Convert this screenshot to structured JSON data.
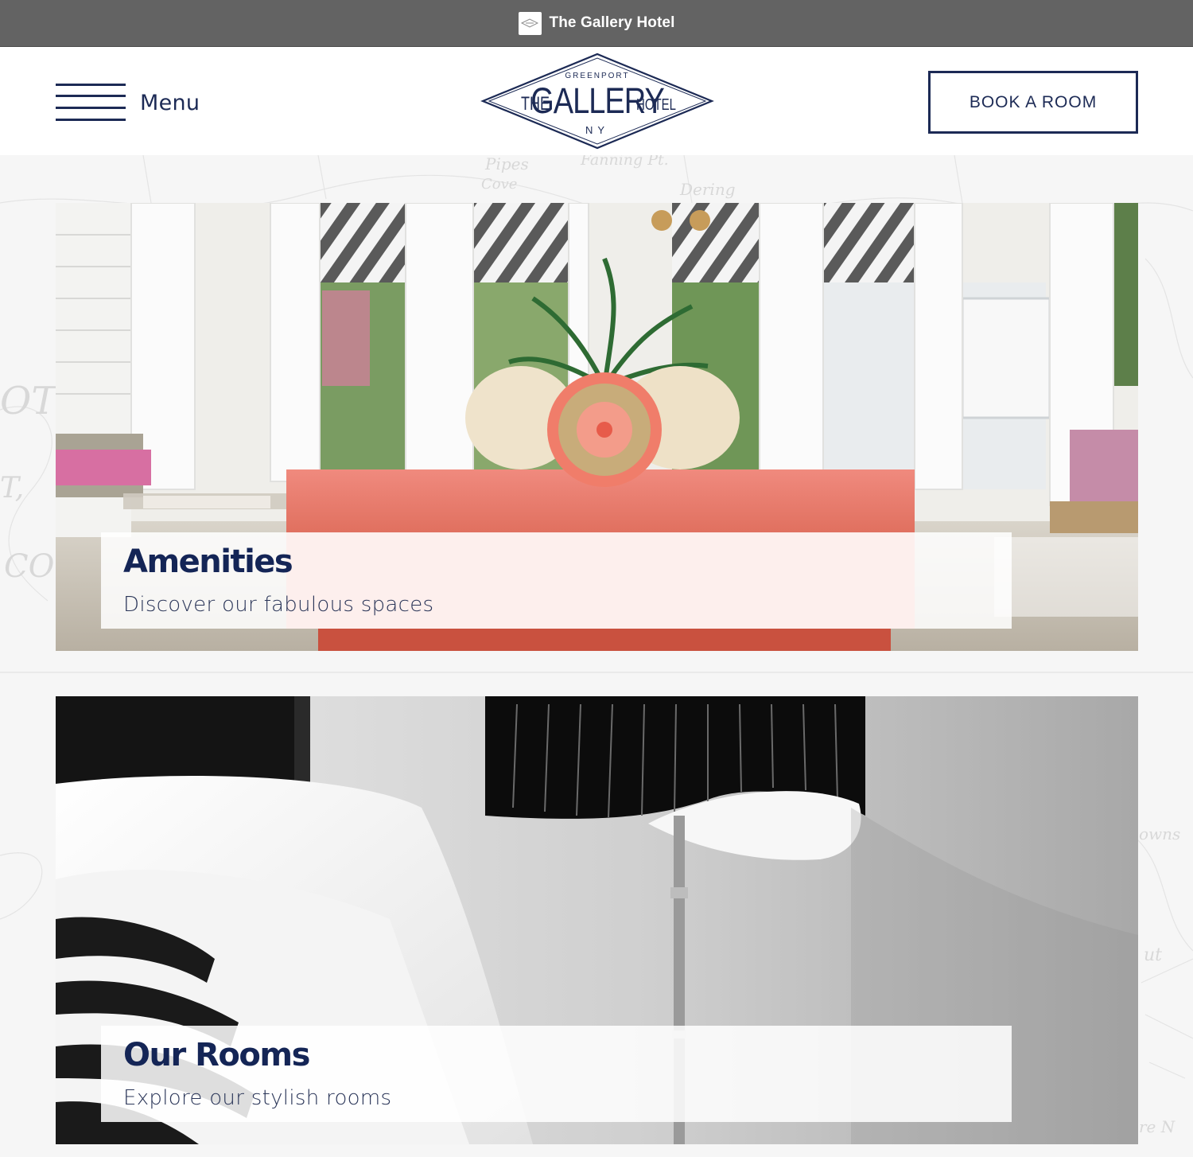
{
  "browser": {
    "title": "The Gallery Hotel"
  },
  "header": {
    "menu_label": "Menu",
    "book_label": "BOOK A ROOM",
    "logo": {
      "top": "GREENPORT",
      "left": "THE",
      "main": "GALLERY",
      "right": "HOTEL",
      "bottom": "NY"
    }
  },
  "cards": [
    {
      "title": "Amenities",
      "subtitle": "Discover our fabulous spaces"
    },
    {
      "title": "Our Rooms",
      "subtitle": "Explore our stylish rooms"
    }
  ],
  "map": {
    "labels": [
      "Pipes",
      "Cove",
      "Fanning Pt.",
      "Dering",
      "OTE",
      "CO",
      "T,",
      "owns",
      "ut",
      "re N"
    ]
  },
  "colors": {
    "brand_navy": "#1c2a55",
    "titlebar": "#636363",
    "background": "#f6f6f6"
  }
}
